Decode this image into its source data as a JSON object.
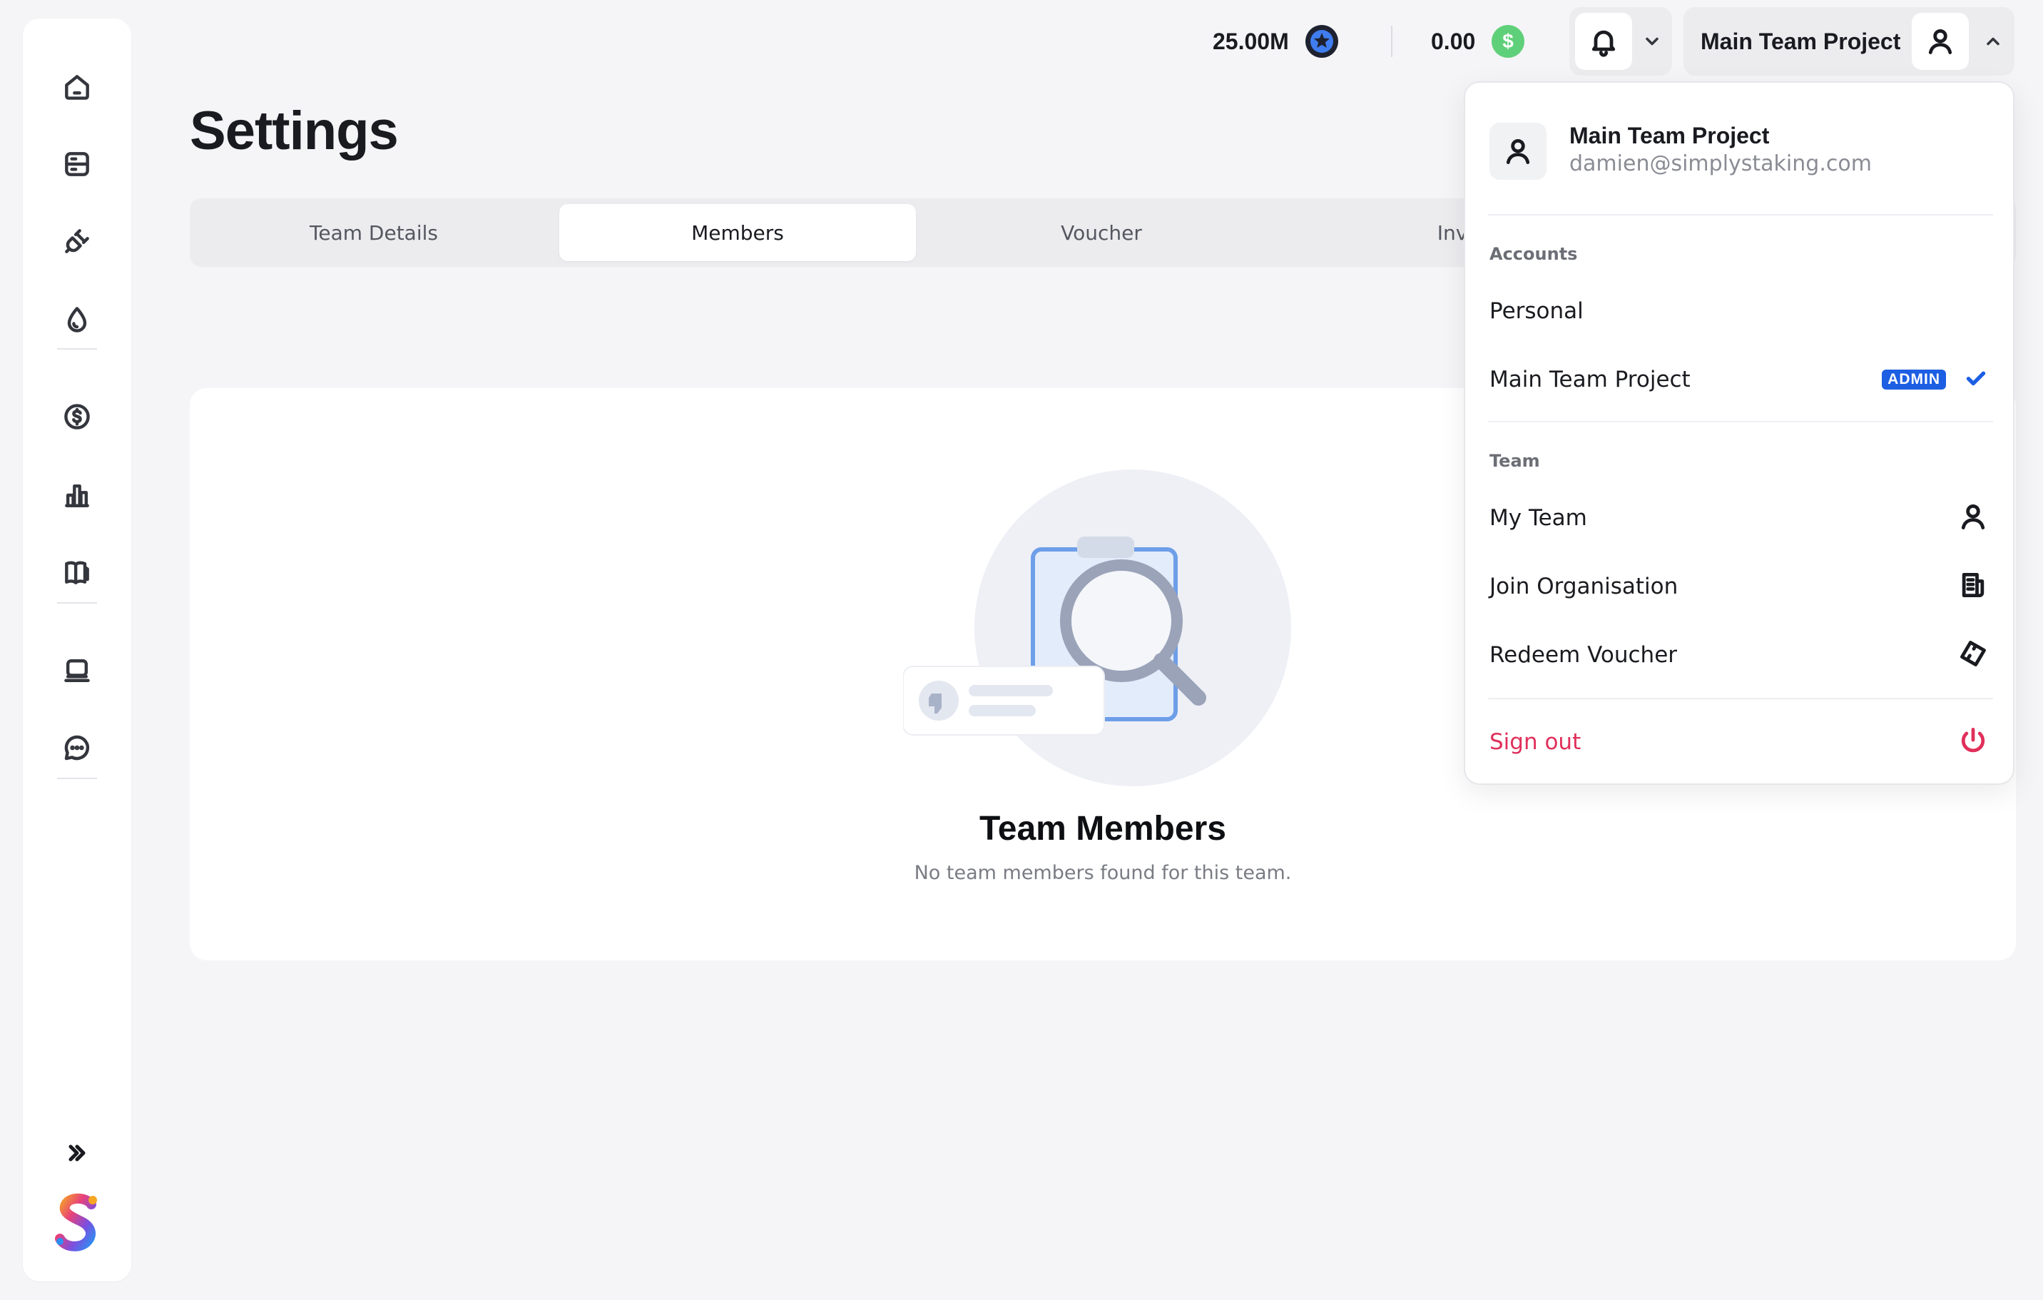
{
  "sidebar": {
    "icons": [
      "home-icon",
      "server-icon",
      "plug-icon",
      "drop-icon",
      "dollar-icon",
      "chart-icon",
      "book-icon",
      "laptop-icon",
      "chat-icon"
    ],
    "expand_icon": "double-chevron-right-icon"
  },
  "topbar": {
    "token_balance": "25.00M",
    "token_icon": "star-coin-icon",
    "usd_balance": "0.00",
    "usd_icon": "dollar-coin-icon",
    "account_name": "Main Team Project"
  },
  "page": {
    "title": "Settings",
    "tabs": [
      {
        "label": "Team Details"
      },
      {
        "label": "Members"
      },
      {
        "label": "Voucher"
      },
      {
        "label": "Invita"
      }
    ],
    "active_tab": "Members"
  },
  "empty_state": {
    "title": "Team Members",
    "subtitle": "No team members found for this team."
  },
  "dropdown": {
    "name": "Main Team Project",
    "email": "damien@simplystaking.com",
    "accounts_heading": "Accounts",
    "accounts": [
      {
        "label": "Personal"
      },
      {
        "label": "Main Team Project",
        "badge": "ADMIN"
      }
    ],
    "team_heading": "Team",
    "team_items": [
      {
        "label": "My Team"
      },
      {
        "label": "Join Organisation"
      },
      {
        "label": "Redeem Voucher"
      }
    ],
    "sign_out": "Sign out"
  },
  "colors": {
    "accent": "#1d5fe3",
    "danger": "#e0305a",
    "background": "#f5f5f7"
  }
}
